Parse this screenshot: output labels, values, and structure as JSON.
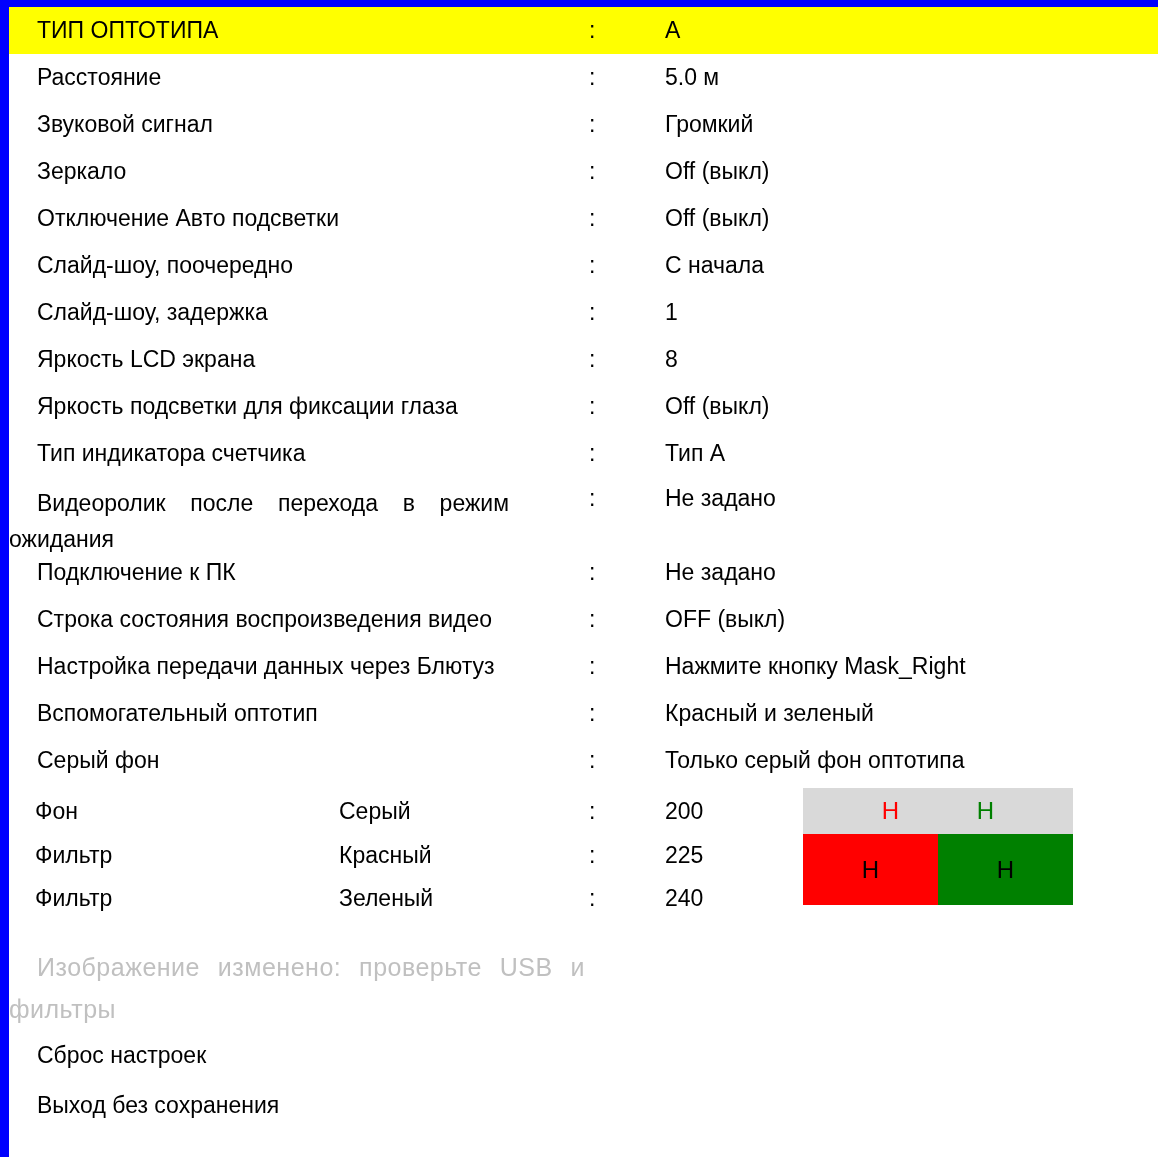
{
  "settings": [
    {
      "label": "ТИП ОПТОТИПА",
      "value": "A",
      "selected": true
    },
    {
      "label": "Расстояние",
      "value": "5.0 м",
      "selected": false
    },
    {
      "label": "Звуковой сигнал",
      "value": "Громкий",
      "selected": false
    },
    {
      "label": "Зеркало",
      "value": "Off (выкл)",
      "selected": false
    },
    {
      "label": "Отключение Авто подсветки",
      "value": "Off (выкл)",
      "selected": false
    },
    {
      "label": "Слайд-шоу, поочередно",
      "value": "С начала",
      "selected": false
    },
    {
      "label": "Слайд-шоу, задержка",
      "value": "1",
      "selected": false
    },
    {
      "label": "Яркость LCD экрана",
      "value": "8",
      "selected": false
    },
    {
      "label": "Яркость подсветки для фиксации глаза",
      "value": "Off (выкл)",
      "selected": false
    },
    {
      "label": "Тип индикатора счетчика",
      "value": "Тип A",
      "selected": false
    },
    {
      "label": "Видеоролик после перехода в режим ожидания",
      "value": "Не задано",
      "selected": false
    },
    {
      "label": "Подключение к ПК",
      "value": "Не задано",
      "selected": false
    },
    {
      "label": "Строка состояния воспроизведения видео",
      "value": "OFF (выкл)",
      "selected": false
    },
    {
      "label": "Настройка передачи данных через Блютуз",
      "value": "Нажмите кнопку Mask_Right",
      "selected": false
    },
    {
      "label": "Вспомогательный оптотип",
      "value": "Красный и зеленый",
      "selected": false
    },
    {
      "label": "Серый фон",
      "value": "Только серый фон оптотипа",
      "selected": false
    }
  ],
  "separator": ":",
  "colors": [
    {
      "label": "Фон",
      "channel": "Серый",
      "value": "200"
    },
    {
      "label": "Фильтр",
      "channel": "Красный",
      "value": "225"
    },
    {
      "label": "Фильтр",
      "channel": "Зеленый",
      "value": "240"
    }
  ],
  "preview": {
    "top": [
      {
        "letter": "Н",
        "color": "#ff0000"
      },
      {
        "letter": "Н",
        "color": "#008000"
      }
    ],
    "bottom": [
      {
        "letter": "Н",
        "color": "#ff0000"
      },
      {
        "letter": "Н",
        "color": "#008000"
      }
    ]
  },
  "notice": {
    "text": "Изображение изменено: проверьте USB и фильтры",
    "disabled": true
  },
  "actions": [
    {
      "label": "Сброс настроек",
      "selected": false
    },
    {
      "label": "Выход без сохранения",
      "selected": false
    }
  ]
}
